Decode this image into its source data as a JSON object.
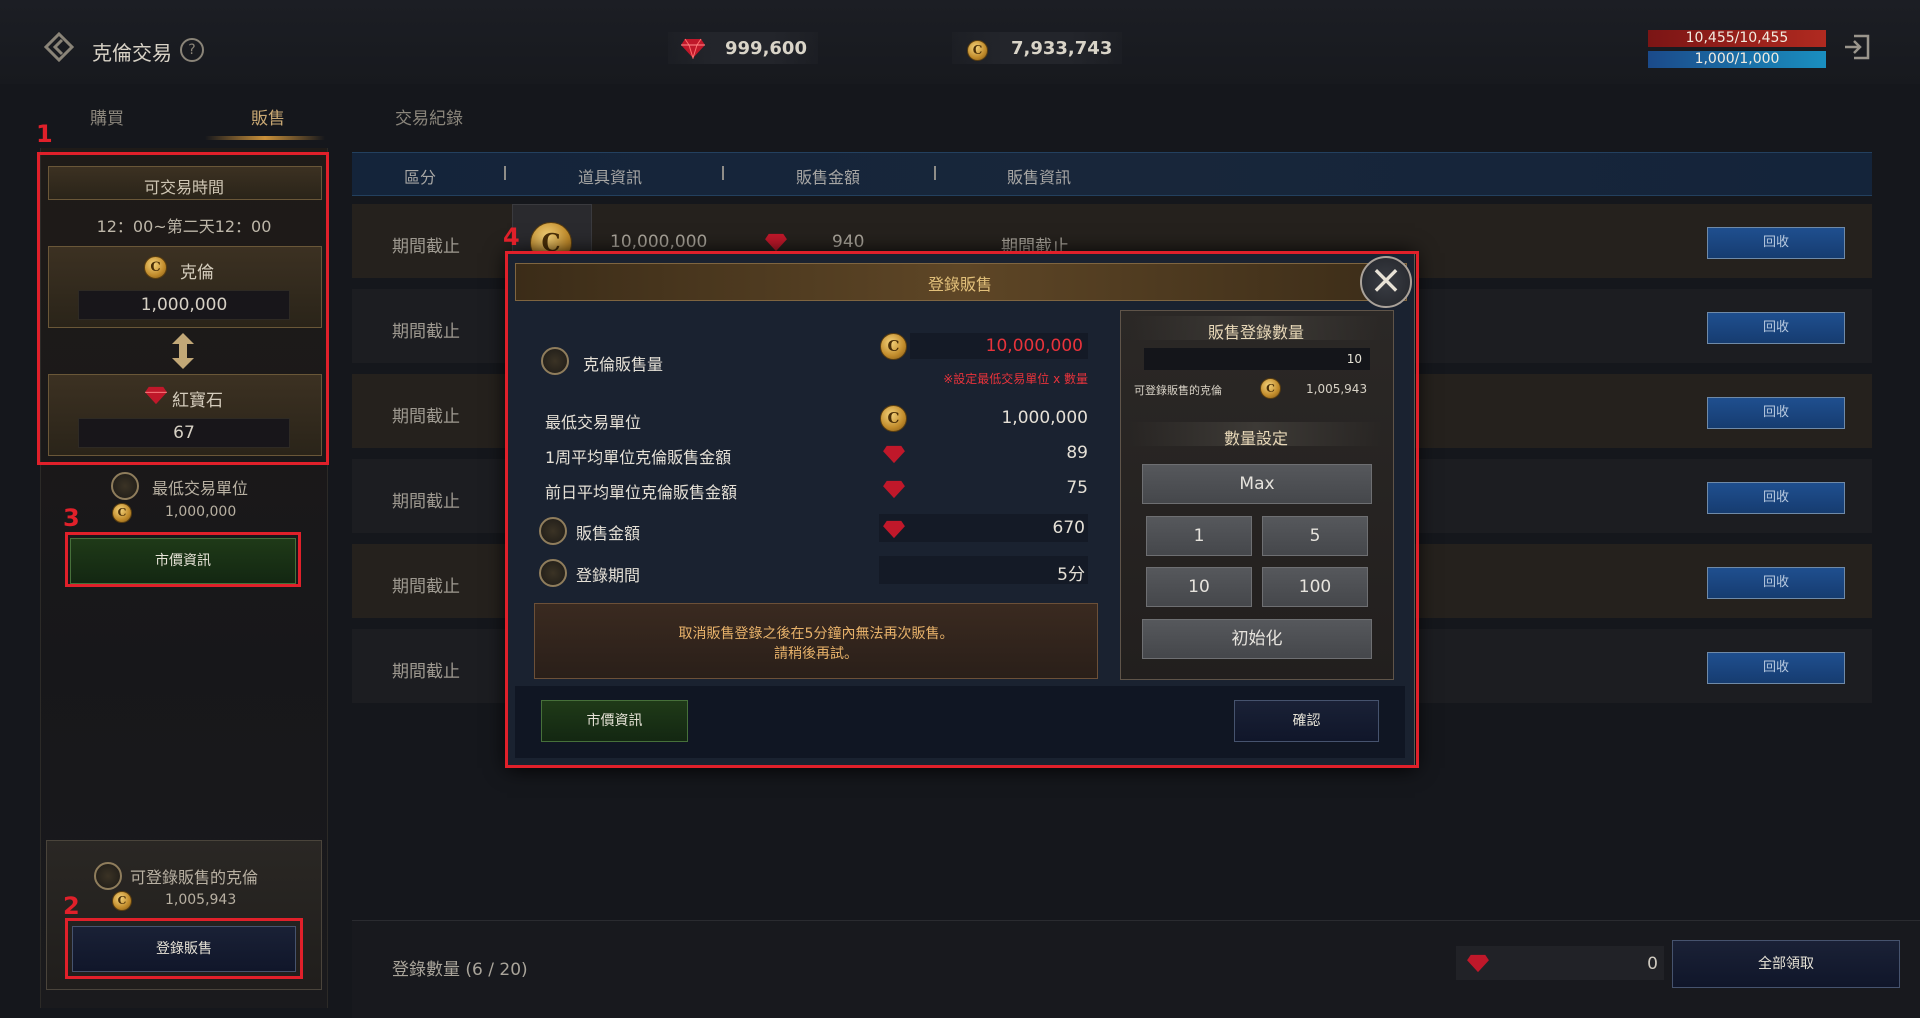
{
  "header": {
    "title": "克倫交易",
    "help": "?",
    "ruby_amount": "999,600",
    "coin_amount": "7,933,743",
    "hp": "10,455/10,455",
    "mp": "1,000/1,000"
  },
  "tabs": [
    {
      "label": "購買"
    },
    {
      "label": "販售"
    },
    {
      "label": "交易紀錄"
    }
  ],
  "sidebar": {
    "trade_time_label": "可交易時間",
    "trade_time": "12：00~第二天12：00",
    "keren_label": "克倫",
    "keren_value": "1,000,000",
    "ruby_label": "紅寶石",
    "ruby_value": "67",
    "min_unit_label": "最低交易單位",
    "min_unit_value": "1,000,000",
    "market_button": "市價資訊",
    "registrable_label": "可登錄販售的克倫",
    "registrable_value": "1,005,943",
    "register_button": "登錄販售"
  },
  "annotations": [
    "1",
    "2",
    "3",
    "4"
  ],
  "table": {
    "headers": [
      "區分",
      "道具資訊",
      "販售金額",
      "販售資訊"
    ],
    "first_row": {
      "amount": "10,000,000",
      "price": "940",
      "info": "期間截止"
    },
    "rows": [
      {
        "status": "期間截止",
        "button": "回收"
      },
      {
        "status": "期間截止",
        "button": "回收"
      },
      {
        "status": "期間截止",
        "button": "回收"
      },
      {
        "status": "期間截止",
        "button": "回收"
      },
      {
        "status": "期間截止",
        "button": "回收"
      },
      {
        "status": "期間截止",
        "button": "回收"
      }
    ]
  },
  "footer": {
    "count_label": "登錄數量 (6 / 20)",
    "ruby_total": "0",
    "collect_all": "全部領取"
  },
  "modal": {
    "title": "登錄販售",
    "sell_amount_label": "克倫販售量",
    "sell_amount_value": "10,000,000",
    "sell_amount_note": "※設定最低交易單位 x 數量",
    "min_unit_label": "最低交易單位",
    "min_unit_value": "1,000,000",
    "week_avg_label": "1周平均單位克倫販售金額",
    "week_avg_value": "89",
    "prev_day_label": "前日平均單位克倫販售金額",
    "prev_day_value": "75",
    "sale_price_label": "販售金額",
    "sale_price_value": "670",
    "period_label": "登錄期間",
    "period_value": "5分",
    "notice_line1": "取消販售登錄之後在5分鐘內無法再次販售。",
    "notice_line2": "請稍後再試。",
    "qty_heading": "販售登錄數量",
    "qty_value": "10",
    "registrable_label": "可登錄販售的克倫",
    "registrable_value": "1,005,943",
    "qty_set_heading": "數量設定",
    "btn_max": "Max",
    "btn_1": "1",
    "btn_5": "5",
    "btn_10": "10",
    "btn_100": "100",
    "btn_reset": "初始化",
    "market_button": "市價資訊",
    "confirm_button": "確認"
  },
  "colors": {
    "annotation_red": "#e0202a",
    "accent_gold": "#e2c07a",
    "warning_red": "#e8333b"
  }
}
